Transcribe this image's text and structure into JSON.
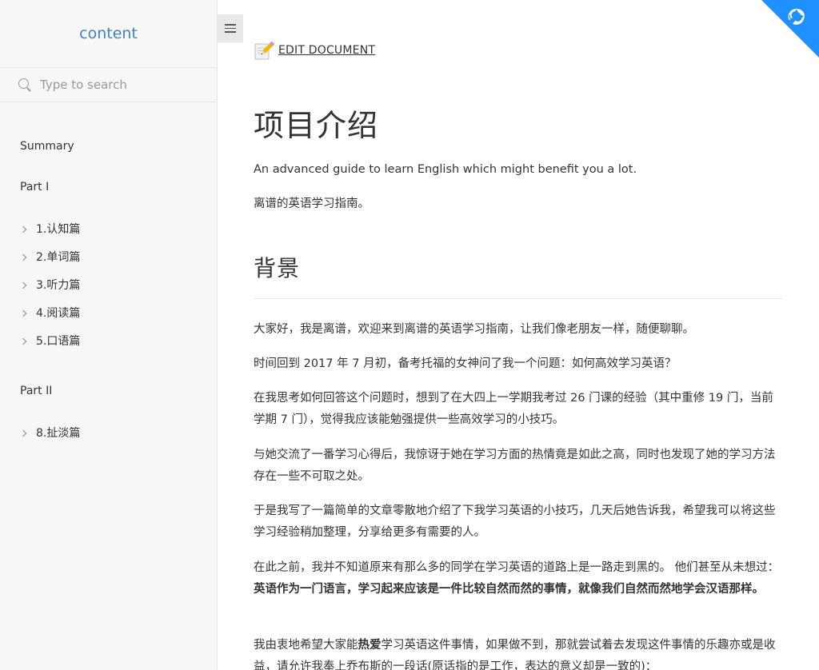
{
  "sidebar": {
    "brand": "content",
    "search_placeholder": "Type to search",
    "summary": "Summary",
    "part1": "Part I",
    "items_part1": [
      "1.认知篇",
      "2.单词篇",
      "3.听力篇",
      "4.阅读篇",
      "5.口语篇"
    ],
    "part2": "Part II",
    "items_part2": [
      "8.扯淡篇"
    ]
  },
  "main": {
    "edit_label": "EDIT DOCUMENT",
    "title": "项目介绍",
    "intro_en": "An advanced guide to learn English which might benefit you a lot.",
    "intro_cn": "离谱的英语学习指南。",
    "heading_bg": "背景",
    "p1": "大家好，我是离谱，欢迎来到离谱的英语学习指南，让我们像老朋友一样，随便聊聊。",
    "p2": "时间回到 2017 年 7 月初，备考托福的女神问了我一个问题：如何高效学习英语？",
    "p3": "在我思考如何回答这个问题时，想到了在大四上一学期我考过 26 门课的经验（其中重修 19 门，当前学期 7 门），觉得我应该能勉强提供一些高效学习的小技巧。",
    "p4": "与她交流了一番学习心得后，我惊讶于她在学习方面的热情竟是如此之高，同时也发现了她的学习方法存在一些不可取之处。",
    "p5": "于是我写了一篇简单的文章零散地介绍了下我学习英语的小技巧，几天后她告诉我，希望我可以将这些学习经验稍加整理，分享给更多有需要的人。",
    "p6_a": "在此之前，我并不知道原来有那么多的同学在学习英语的道路上是一路走到黑的。 他们甚至从未想过：",
    "p6_b": "英语作为一门语言，学习起来应该是一件比较自然而然的事情，就像我们自然而然地学会汉语那样",
    "p6_c": "。",
    "p7_a": "我由衷地希望大家能",
    "p7_b": "热爱",
    "p7_c": "学习英语这件事情，如果做不到，那就尝试着去发现这件事情的乐趣亦或是收益，请允许我奉上乔布斯的一段话(原话指的是工作，表达的意义却是一致的)："
  },
  "colors": {
    "brand": "#4183c4",
    "corner": "#1e90ff",
    "sidebar_bg": "#f7f7f7"
  }
}
